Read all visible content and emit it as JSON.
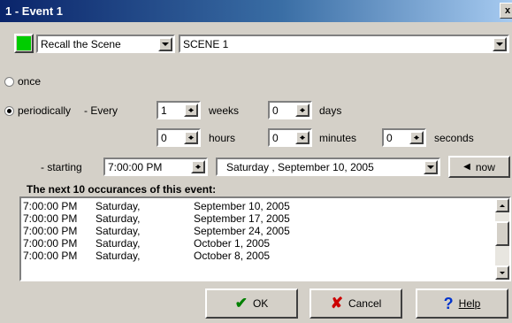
{
  "window": {
    "title": "1 - Event 1",
    "close_glyph": "x"
  },
  "color": "#00cc00",
  "action": {
    "selected": "Recall the Scene"
  },
  "target": {
    "selected": "SCENE 1"
  },
  "options": {
    "once_label": "once",
    "periodically_label": "periodically",
    "selected": "periodically"
  },
  "interval": {
    "every_label": "- Every",
    "weeks_value": "1",
    "weeks_label": "weeks",
    "days_value": "0",
    "days_label": "days",
    "hours_value": "0",
    "hours_label": "hours",
    "minutes_value": "0",
    "minutes_label": "minutes",
    "seconds_value": "0",
    "seconds_label": "seconds"
  },
  "starting": {
    "label": "- starting",
    "time_value": "7:00:00 PM",
    "date_value": "Saturday   , September 10, 2005",
    "now_label": "now"
  },
  "occurrences": {
    "heading": "The next 10 occurances of this event:",
    "rows": [
      {
        "time": "7:00:00 PM",
        "day": "Saturday,",
        "date": "September 10, 2005"
      },
      {
        "time": "7:00:00 PM",
        "day": "Saturday,",
        "date": "September 17, 2005"
      },
      {
        "time": "7:00:00 PM",
        "day": "Saturday,",
        "date": "September 24, 2005"
      },
      {
        "time": "7:00:00 PM",
        "day": "Saturday,",
        "date": "October 1, 2005"
      },
      {
        "time": "7:00:00 PM",
        "day": "Saturday,",
        "date": "October 8, 2005"
      }
    ]
  },
  "buttons": {
    "ok": "OK",
    "cancel": "Cancel",
    "help": "Help"
  },
  "colors": {
    "ok_check": "#008000",
    "cancel_x": "#cc0000",
    "help_q": "#0033cc"
  }
}
